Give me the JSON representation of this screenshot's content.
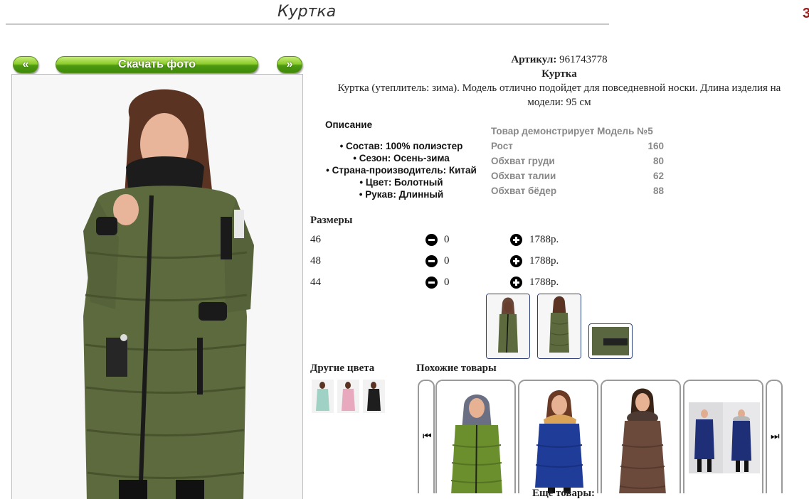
{
  "header": {
    "title": "Куртка",
    "corner_glyph": "3"
  },
  "photo_nav": {
    "prev_label": "«",
    "download_label": "Скачать фото",
    "next_label": "»"
  },
  "product": {
    "article_label": "Артикул:",
    "article_value": "961743778",
    "name": "Куртка",
    "description": "Куртка (утеплитель: зима). Модель отлично подойдет для повседневной носки. Длина изделия на модели: 95 см"
  },
  "description_block": {
    "heading": "Описание",
    "items": [
      "Состав: 100% полиэстер",
      "Сезон: Осень-зима",
      "Страна-производитель: Китай",
      "Цвет: Болотный",
      "Рукав: Длинный"
    ]
  },
  "model_table": {
    "heading": "Товар демонстрирует Модель №5",
    "rows": [
      {
        "label": "Рост",
        "value": "160"
      },
      {
        "label": "Обхват груди",
        "value": "80"
      },
      {
        "label": "Обхват талии",
        "value": "62"
      },
      {
        "label": "Обхват бёдер",
        "value": "88"
      }
    ]
  },
  "sizes": {
    "heading": "Размеры",
    "rows": [
      {
        "size": "46",
        "count": "0",
        "price": "1788р."
      },
      {
        "size": "48",
        "count": "0",
        "price": "1788р."
      },
      {
        "size": "44",
        "count": "0",
        "price": "1788р."
      }
    ]
  },
  "other_colors": {
    "heading": "Другие цвета"
  },
  "similar": {
    "heading": "Похожие товары",
    "prev_glyph": "⏮",
    "next_glyph": "⏭"
  },
  "more": {
    "label": "Ещё товары:"
  },
  "colors": {
    "accent_green": "#5fae1c",
    "jacket_khaki": "#5d6a3e",
    "thumb_border": "#2a3f7a"
  },
  "icons": [
    "minus-circle-icon",
    "plus-circle-icon",
    "skip-previous-icon",
    "skip-next-icon"
  ]
}
